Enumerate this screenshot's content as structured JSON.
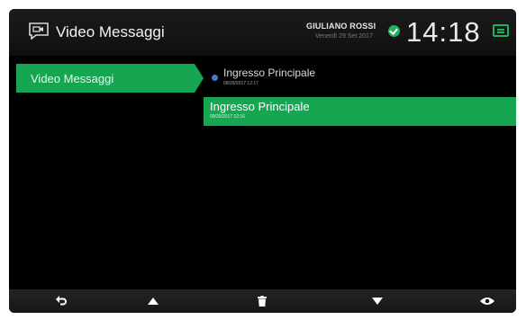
{
  "header": {
    "app_icon": "video-message-icon",
    "title": "Video Messaggi",
    "user_name": "GIULIANO ROSSI",
    "user_date": "Venerdì 29 Set 2017",
    "status_icon": "online-check-icon",
    "clock": "14:18",
    "notification_icon": "message-icon"
  },
  "sidebar": {
    "items": [
      {
        "label": "Video Messaggi",
        "selected": true
      }
    ]
  },
  "messages": {
    "items": [
      {
        "title": "Ingresso Principale",
        "timestamp": "09/29/2017 12:17",
        "unread": true,
        "selected": false
      },
      {
        "title": "Ingresso Principale",
        "timestamp": "09/29/2017 12:16",
        "unread": false,
        "selected": true
      }
    ]
  },
  "toolbar": {
    "back_icon": "back-arrow-icon",
    "up_icon": "triangle-up-icon",
    "delete_icon": "trash-icon",
    "down_icon": "triangle-down-icon",
    "view_icon": "eye-icon"
  },
  "colors": {
    "accent": "#16a651",
    "unread_dot": "#4a73d6",
    "background": "#000000"
  }
}
